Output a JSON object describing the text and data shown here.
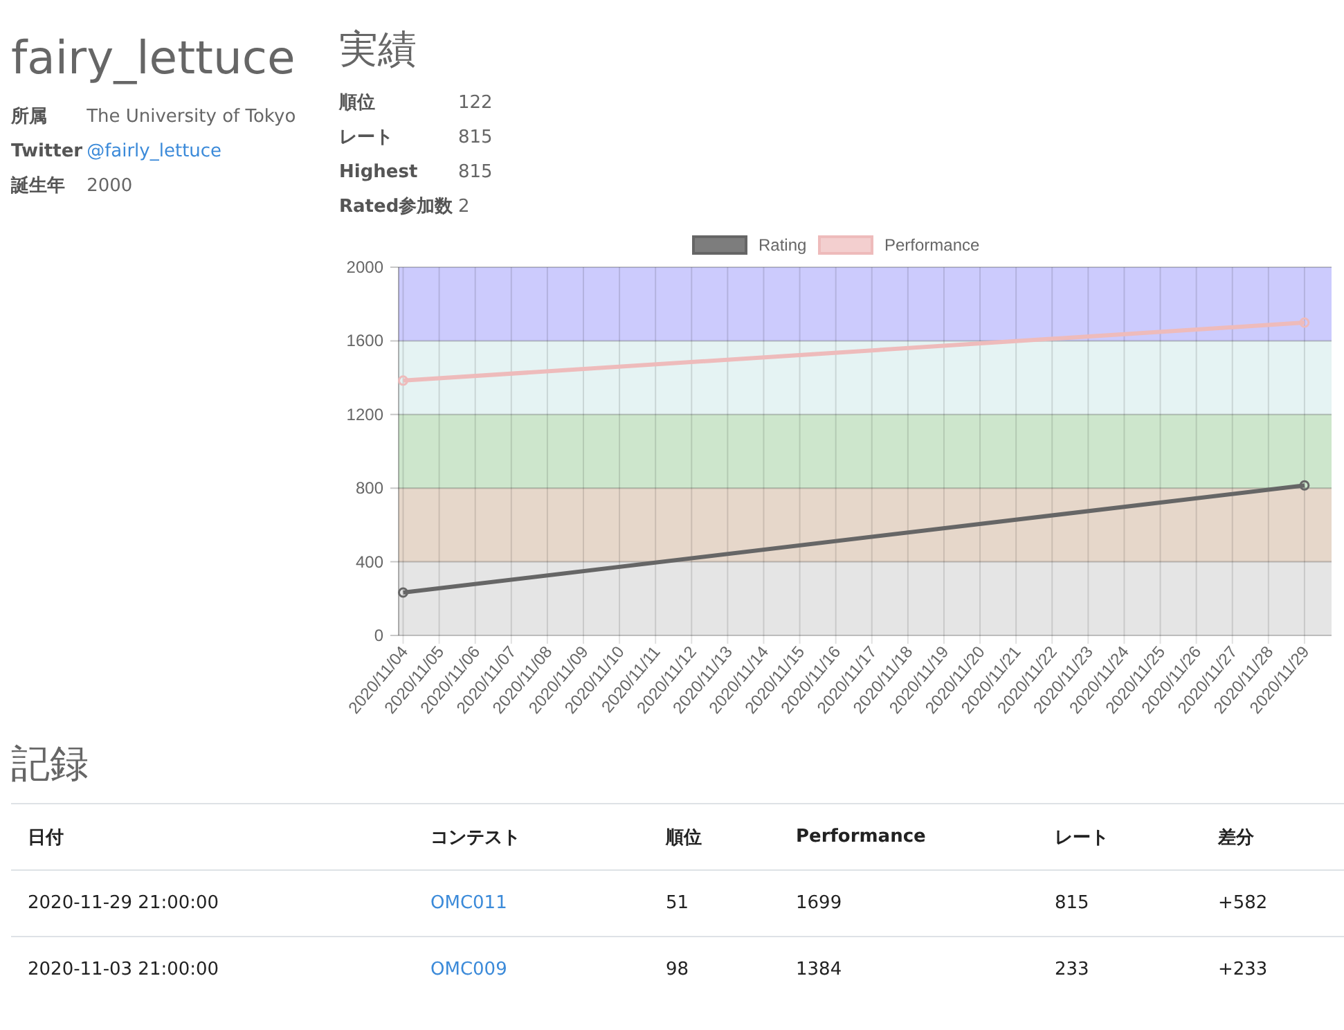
{
  "profile": {
    "username": "fairy_lettuce",
    "fields": [
      {
        "label": "所属",
        "value": "The University of Tokyo",
        "kind": "text"
      },
      {
        "label": "Twitter",
        "value": "@fairly_lettuce",
        "kind": "link"
      },
      {
        "label": "誕生年",
        "value": "2000",
        "kind": "text"
      }
    ]
  },
  "stats": {
    "title": "実績",
    "rows": [
      {
        "label": "順位",
        "value": "122"
      },
      {
        "label": "レート",
        "value": "815"
      },
      {
        "label": "Highest",
        "value": "815"
      },
      {
        "label": "Rated参加数",
        "value": "2"
      }
    ]
  },
  "chart": {
    "chart_data": {
      "type": "line",
      "categories": [
        "2020/11/04",
        "2020/11/05",
        "2020/11/06",
        "2020/11/07",
        "2020/11/08",
        "2020/11/09",
        "2020/11/10",
        "2020/11/11",
        "2020/11/12",
        "2020/11/13",
        "2020/11/14",
        "2020/11/15",
        "2020/11/16",
        "2020/11/17",
        "2020/11/18",
        "2020/11/19",
        "2020/11/20",
        "2020/11/21",
        "2020/11/22",
        "2020/11/23",
        "2020/11/24",
        "2020/11/25",
        "2020/11/26",
        "2020/11/27",
        "2020/11/28",
        "2020/11/29"
      ],
      "series": [
        {
          "name": "Rating",
          "color": "#666666",
          "marker": "circle",
          "values": [
            233,
            null,
            null,
            null,
            null,
            null,
            null,
            null,
            null,
            null,
            null,
            null,
            null,
            null,
            null,
            null,
            null,
            null,
            null,
            null,
            null,
            null,
            null,
            null,
            null,
            815
          ]
        },
        {
          "name": "Performance",
          "color": "#eebbbb",
          "marker": "circle",
          "values": [
            1384,
            null,
            null,
            null,
            null,
            null,
            null,
            null,
            null,
            null,
            null,
            null,
            null,
            null,
            null,
            null,
            null,
            null,
            null,
            null,
            null,
            null,
            null,
            null,
            null,
            1699
          ]
        }
      ],
      "ylim": [
        0,
        2000
      ],
      "yticks": [
        0,
        400,
        800,
        1200,
        1600,
        2000
      ],
      "grid": true,
      "legend": true,
      "bands": [
        {
          "axis": "y",
          "from": 0,
          "to": 400,
          "color": "#e5e5e5"
        },
        {
          "axis": "y",
          "from": 400,
          "to": 800,
          "color": "#e6d7ca"
        },
        {
          "axis": "y",
          "from": 800,
          "to": 1200,
          "color": "#cde6cc"
        },
        {
          "axis": "y",
          "from": 1200,
          "to": 1600,
          "color": "#e5f3f3"
        },
        {
          "axis": "y",
          "from": 1600,
          "to": 2000,
          "color": "#cccbfd"
        }
      ]
    }
  },
  "history": {
    "title": "記録",
    "columns": [
      {
        "label": "日付",
        "kind": "text"
      },
      {
        "label": "コンテスト",
        "kind": "link"
      },
      {
        "label": "順位",
        "kind": "text"
      },
      {
        "label": "Performance",
        "kind": "text"
      },
      {
        "label": "レート",
        "kind": "text"
      },
      {
        "label": "差分",
        "kind": "text"
      }
    ],
    "rows": [
      {
        "cells": [
          "2020-11-29 21:00:00",
          "OMC011",
          "51",
          "1699",
          "815",
          "+582"
        ]
      },
      {
        "cells": [
          "2020-11-03 21:00:00",
          "OMC009",
          "98",
          "1384",
          "233",
          "+233"
        ]
      }
    ]
  }
}
